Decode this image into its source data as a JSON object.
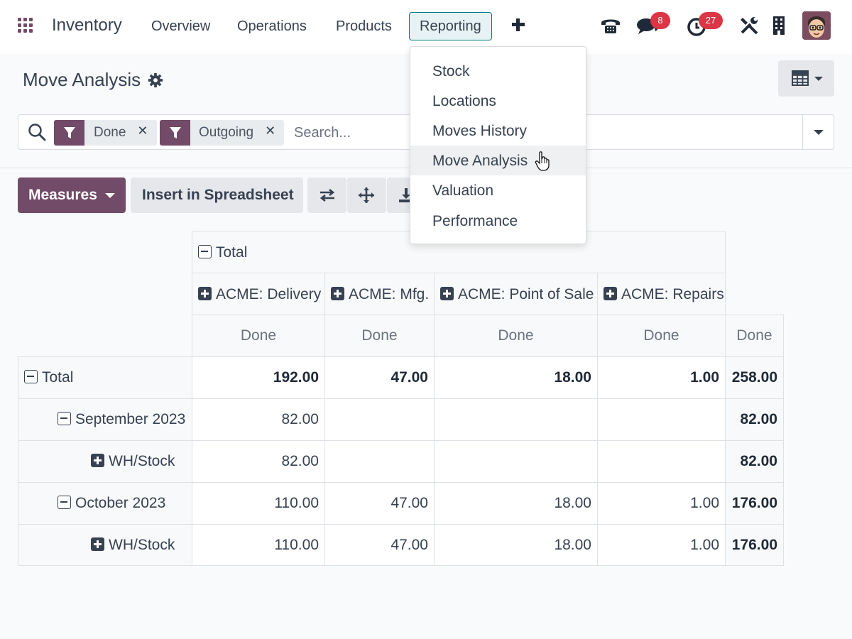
{
  "navbar": {
    "brand": "Inventory",
    "menu": [
      "Overview",
      "Operations",
      "Products",
      "Reporting"
    ],
    "active_menu": "Reporting",
    "messages_badge": "8",
    "activities_badge": "27",
    "icons": [
      "apps-icon",
      "plus-icon",
      "phone-icon",
      "chat-icon",
      "clock-icon",
      "tools-icon",
      "building-icon",
      "avatar"
    ]
  },
  "control_panel": {
    "title": "Move Analysis",
    "filters": [
      {
        "label": "Done",
        "icon": "filter-icon"
      },
      {
        "label": "Outgoing",
        "icon": "filter-icon"
      }
    ],
    "search_placeholder": "Search..."
  },
  "toolbar": {
    "measures_label": "Measures",
    "insert_label": "Insert in Spreadsheet",
    "icons": [
      "flip-axis-icon",
      "expand-all-icon",
      "download-icon"
    ]
  },
  "reporting_menu": {
    "items": [
      "Stock",
      "Locations",
      "Moves History",
      "Move Analysis",
      "Valuation",
      "Performance"
    ],
    "hovered": "Move Analysis"
  },
  "pivot": {
    "col_header_total": "Total",
    "columns": [
      "ACME: Delivery",
      "ACME: Mfg.",
      "ACME: Point of Sale",
      "ACME: Repairs"
    ],
    "measure": "Done",
    "rows": [
      {
        "label": "Total",
        "level": 0,
        "toggle": "minus",
        "values": [
          "192.00",
          "47.00",
          "18.00",
          "1.00"
        ],
        "total": "258.00"
      },
      {
        "label": "September 2023",
        "level": 1,
        "toggle": "minus",
        "values": [
          "82.00",
          "",
          "",
          ""
        ],
        "total": "82.00"
      },
      {
        "label": "WH/Stock",
        "level": 2,
        "toggle": "plus",
        "values": [
          "82.00",
          "",
          "",
          ""
        ],
        "total": "82.00"
      },
      {
        "label": "October 2023",
        "level": 1,
        "toggle": "minus",
        "values": [
          "110.00",
          "47.00",
          "18.00",
          "1.00"
        ],
        "total": "176.00"
      },
      {
        "label": "WH/Stock",
        "level": 2,
        "toggle": "plus",
        "values": [
          "110.00",
          "47.00",
          "18.00",
          "1.00"
        ],
        "total": "176.00"
      }
    ]
  },
  "colors": {
    "brand": "#714B67",
    "active_nav_border": "#017e84",
    "badge": "#dc3545"
  }
}
